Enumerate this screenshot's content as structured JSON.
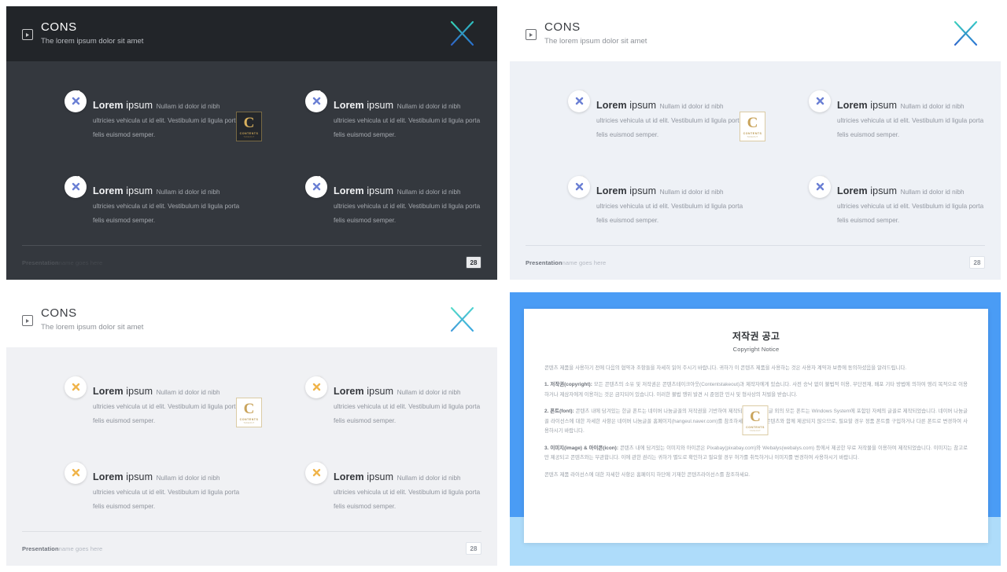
{
  "slides": [
    {
      "id": "slide-dark",
      "theme": "dark",
      "header": {
        "icon": "play-square-icon",
        "title": "CONS",
        "subtitle": "The lorem ipsum dolor sit amet",
        "logo": "x-brand-logo"
      },
      "cards": [
        {
          "badge": "x-close-icon",
          "title_bold": "Lorem",
          "title_rest": " ipsum",
          "desc": "Nullam id dolor id nibh ultricies vehicula ut id elit. Vestibulum id ligula porta felis euismod semper."
        },
        {
          "badge": "x-close-icon",
          "title_bold": "Lorem",
          "title_rest": " ipsum",
          "desc": "Nullam id dolor id nibh ultricies vehicula ut id elit. Vestibulum id ligula porta felis euismod semper."
        },
        {
          "badge": "x-close-icon",
          "title_bold": "Lorem",
          "title_rest": " ipsum",
          "desc": "Nullam id dolor id nibh ultricies vehicula ut id elit. Vestibulum id ligula porta felis euismod semper."
        },
        {
          "badge": "x-close-icon",
          "title_bold": "Lorem",
          "title_rest": " ipsum",
          "desc": "Nullam id dolor id nibh ultricies vehicula ut id elit. Vestibulum id ligula porta felis euismod semper."
        }
      ],
      "footer": {
        "brand": "Presentation",
        "tagline": "name goes here",
        "page": "28"
      },
      "watermark": {
        "letter": "C",
        "line1": "CONTENTS",
        "line2": "TAKEOUT"
      }
    },
    {
      "id": "slide-light-blue",
      "theme": "light",
      "header": {
        "icon": "play-square-icon",
        "title": "CONS",
        "subtitle": "The lorem ipsum dolor sit amet",
        "logo": "x-brand-logo"
      },
      "cards": [
        {
          "badge": "x-close-icon",
          "title_bold": "Lorem",
          "title_rest": " ipsum",
          "desc": "Nullam id dolor id nibh ultricies vehicula ut id elit. Vestibulum id ligula porta felis euismod semper."
        },
        {
          "badge": "x-close-icon",
          "title_bold": "Lorem",
          "title_rest": " ipsum",
          "desc": "Nullam id dolor id nibh ultricies vehicula ut id elit. Vestibulum id ligula porta felis euismod semper."
        },
        {
          "badge": "x-close-icon",
          "title_bold": "Lorem",
          "title_rest": " ipsum",
          "desc": "Nullam id dolor id nibh ultricies vehicula ut id elit. Vestibulum id ligula porta felis euismod semper."
        },
        {
          "badge": "x-close-icon",
          "title_bold": "Lorem",
          "title_rest": " ipsum",
          "desc": "Nullam id dolor id nibh ultricies vehicula ut id elit. Vestibulum id ligula porta felis euismod semper."
        }
      ],
      "footer": {
        "brand": "Presentation",
        "tagline": "name goes here",
        "page": "28"
      },
      "watermark": {
        "letter": "C",
        "line1": "CONTENTS",
        "line2": "TAKEOUT"
      }
    },
    {
      "id": "slide-light-gray",
      "theme": "light",
      "header": {
        "icon": "play-square-icon",
        "title": "CONS",
        "subtitle": "The lorem ipsum dolor sit amet",
        "logo": "x-brand-logo"
      },
      "cards": [
        {
          "badge": "x-close-icon",
          "title_bold": "Lorem",
          "title_rest": " ipsum",
          "desc": "Nullam id dolor id nibh ultricies vehicula ut id elit. Vestibulum id ligula porta felis euismod semper."
        },
        {
          "badge": "x-close-icon",
          "title_bold": "Lorem",
          "title_rest": " ipsum",
          "desc": "Nullam id dolor id nibh ultricies vehicula ut id elit. Vestibulum id ligula porta felis euismod semper."
        },
        {
          "badge": "x-close-icon",
          "title_bold": "Lorem",
          "title_rest": " ipsum",
          "desc": "Nullam id dolor id nibh ultricies vehicula ut id elit. Vestibulum id ligula porta felis euismod semper."
        },
        {
          "badge": "x-close-icon",
          "title_bold": "Lorem",
          "title_rest": " ipsum",
          "desc": "Nullam id dolor id nibh ultricies vehicula ut id elit. Vestibulum id ligula porta felis euismod semper."
        }
      ],
      "footer": {
        "brand": "Presentation",
        "tagline": "name goes here",
        "page": "28"
      },
      "watermark": {
        "letter": "C",
        "line1": "CONTENTS",
        "line2": "TAKEOUT"
      }
    }
  ],
  "copyright": {
    "title": "저작권 공고",
    "subtitle": "Copyright Notice",
    "intro": "콘텐츠 제품을 사용하기 전에 다음의 협약과 조항들을 자세히 읽어 주시기 바랍니다. 귀하가 이 콘텐츠 제품을 사용하는 것은 사용자 계약과 보증에 동의하셨음을 알려드립니다.",
    "items": [
      {
        "label": "1. 저작권(copyright):",
        "text": " 모든 콘텐츠의 소유 및 저작권은 콘텐츠테이크아웃(Contentstakeout)과 제작자에게 있습니다. 사전 승낙 없이 불법적 이용, 무단전재, 배포 기타 방법에 의하여 영리 목적으로 이용하거나 제삼자에게 이용하는 것은 금지되어 있습니다. 이러한 불법 행위 발견 시 준엄한 민사 및 형사상의 처벌을 받습니다."
      },
      {
        "label": "2. 폰트(font):",
        "text": " 콘텐츠 내에 담겨있는 한글 폰트는 네이버 나눔글꼴의 저작권을 기반하여 제작되었습니다. 한글 외의 모든 폰트는 Windows System에 포함된 자체의 글꼴로 제작되었습니다. 네이버 나눔글꼴 라이선스에 대한 자세한 사항은 네이버 나눔글꼴 홈페이지(hangeul.naver.com)를 참조하세요. 폰트는 콘텐츠와 함께 제공되지 않으므로, 필요할 경우 정품 폰트를 구입하거나 다른 폰트로 변경하여 사용하시기 바랍니다."
      },
      {
        "label": "3. 이미지(image) & 아이콘(icon):",
        "text": " 콘텐츠 내에 담겨있는 이미지와 아이콘은 Pixabay(pixabay.com)와 Webalys(webalys.com) 등에서 제공한 무료 저작물을 이용하여 제작되었습니다. 이미지는 참고로만 제공되고 콘텐츠와는 무관합니다. 이에 관한 권리는 귀하가 별도로 확인하고 필요할 경우 허가를 취득하거나 이미지를 변경하여 사용하시기 바랍니다."
      }
    ],
    "outro": "콘텐츠 제품 라이선스에 대한 자세한 사항은 홈페이지 하단에 기재한 콘텐츠라이선스를 참조하세요.",
    "watermark": {
      "letter": "C",
      "line1": "CONTENTS",
      "line2": "TAKEOUT"
    }
  },
  "colors": {
    "dark_header": "#222529",
    "dark_body": "#34383e",
    "blue_accent": "#4a9cf5",
    "blue_light": "#aedcfa",
    "badge_blue": "#6a7fd4",
    "badge_orange": "#f0b44a",
    "logo_gold": "#c9a45c",
    "x_teal": "#2fc4b2",
    "x_blue": "#2f7fd6"
  }
}
